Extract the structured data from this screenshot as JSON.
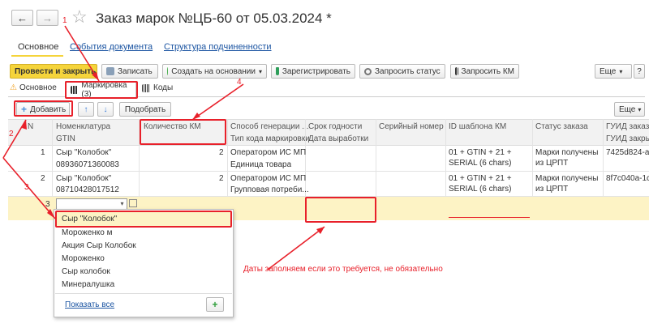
{
  "window": {
    "title": "Заказ марок №ЦБ-60 от 05.03.2024 *",
    "back_icon": "←",
    "forward_icon": "→",
    "star_icon": "☆"
  },
  "nav_tabs": [
    "Основное",
    "События документа",
    "Структура подчиненности"
  ],
  "toolbar": {
    "post_close": "Провести и закрыть",
    "save": "Записать",
    "create_based": "Создать на основании",
    "register": "Зарегистрировать",
    "request_status": "Запросить статус",
    "request_km": "Запросить КМ",
    "more": "Еще",
    "help": "?"
  },
  "inner_tabs": [
    "Основное",
    "Маркировка (3)",
    "Коды"
  ],
  "sub_toolbar": {
    "add": "Добавить",
    "select": "Подобрать",
    "more": "Еще"
  },
  "table": {
    "headers_top": [
      "N",
      "Номенклатура",
      "Количество КМ",
      "Способ генерации ...",
      "Срок годности",
      "Серийный номер",
      "ID шаблона КМ",
      "Статус заказа",
      "ГУИД заказа"
    ],
    "headers_bottom": [
      "GTIN",
      "Тип кода маркировки",
      "Дата выработки",
      "ГУИД закры"
    ],
    "rows": [
      {
        "n": "1",
        "name": "Сыр \"Колобок\"",
        "gtin": "08936071360083",
        "qty": "2",
        "gen_method": "Оператором ИС МП",
        "code_type": "Единица товара",
        "template": "01 + GTIN + 21 +",
        "template2": "SERIAL (6 chars)",
        "status": "Марки получены",
        "status2": "из ЦРПТ",
        "guid": "7425d824-aa"
      },
      {
        "n": "2",
        "name": "Сыр \"Колобок\"",
        "gtin": "08710428017512",
        "qty": "2",
        "gen_method": "Оператором ИС МП",
        "code_type": "Групповая потреби...",
        "template": "01 + GTIN + 21 +",
        "template2": "SERIAL (6 chars)",
        "status": "Марки получены",
        "status2": "из ЦРПТ",
        "guid": "8f7c040a-1c"
      },
      {
        "n": "3"
      }
    ]
  },
  "dropdown": {
    "items": [
      "Сыр \"Колобок\"",
      "Мороженко м",
      "Акция  Сыр Колобок",
      "Мороженко",
      "Сыр колобок",
      "Минералушка"
    ],
    "show_all": "Показать все",
    "add_icon": "+"
  },
  "annotations": {
    "labels": [
      "1",
      "2",
      "3",
      "4"
    ],
    "note": "Даты заполняем если это требуется, не обязательно"
  },
  "colors": {
    "accent_yellow": "#f5d43b",
    "selected_row": "#fdf3c5",
    "annotation_red": "#e8202a",
    "link_blue": "#1c55a2"
  }
}
